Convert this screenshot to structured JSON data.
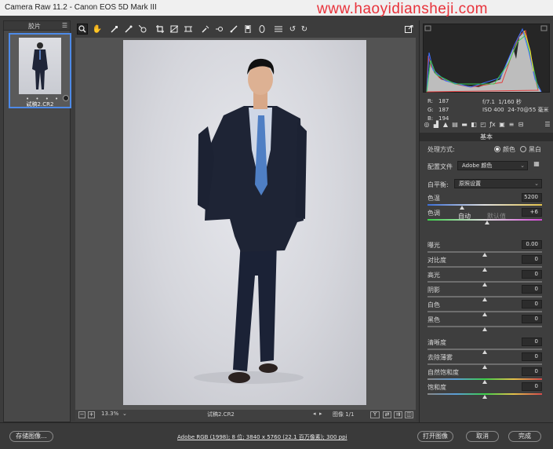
{
  "window": {
    "title": "Camera Raw 11.2 -  Canon EOS 5D Mark III",
    "watermark": "www.haoyidiansheji.com"
  },
  "filmstrip": {
    "label": "胶片",
    "thumbnail": {
      "stars": "• • • • •",
      "filename": "试稿2.CR2"
    }
  },
  "toolbar": {
    "tools": [
      "zoom-icon",
      "hand-icon",
      "white-balance-icon",
      "color-sampler-icon",
      "target-adjust-icon",
      "crop-icon",
      "straighten-icon",
      "transform-icon",
      "spot-removal-icon",
      "red-eye-icon",
      "adjustment-brush-icon",
      "graduated-filter-icon",
      "radial-filter-icon",
      "presets-icon",
      "rotate-ccw-icon",
      "rotate-cw-icon"
    ],
    "open_in_ps": "export-icon"
  },
  "bottombar": {
    "zoom": "13.3%",
    "filename": "试稿2.CR2",
    "image_count": "图像 1/1",
    "compare_label": "Y"
  },
  "histogram": {
    "r": "187",
    "g": "187",
    "b": "194",
    "r_label": "R:",
    "g_label": "G:",
    "b_label": "B:",
    "aperture": "f/7.1",
    "shutter": "1/160 秒",
    "iso": "ISO 400",
    "lens": "24-70@55 毫米"
  },
  "panel": {
    "title": "基本",
    "treatment_label": "处理方式:",
    "treatment_color": "颜色",
    "treatment_bw": "黑白",
    "profile_label": "配置文件",
    "profile_value": "Adobe 颜色",
    "wb_label": "白平衡:",
    "wb_value": "原照设置",
    "auto": "自动",
    "default": "默认值",
    "sliders": [
      {
        "label": "色温",
        "value": "5200",
        "pos": 0.3
      },
      {
        "label": "色调",
        "value": "+6",
        "pos": 0.52
      },
      {
        "label": "曝光",
        "value": "0.00",
        "pos": 0.5
      },
      {
        "label": "对比度",
        "value": "0",
        "pos": 0.5
      },
      {
        "label": "高光",
        "value": "0",
        "pos": 0.5
      },
      {
        "label": "阴影",
        "value": "0",
        "pos": 0.5
      },
      {
        "label": "白色",
        "value": "0",
        "pos": 0.5
      },
      {
        "label": "黑色",
        "value": "0",
        "pos": 0.5
      },
      {
        "label": "清晰度",
        "value": "0",
        "pos": 0.5
      },
      {
        "label": "去除薄雾",
        "value": "0",
        "pos": 0.5
      },
      {
        "label": "自然饱和度",
        "value": "0",
        "pos": 0.5
      },
      {
        "label": "饱和度",
        "value": "0",
        "pos": 0.5
      }
    ]
  },
  "footer": {
    "save": "存储图像...",
    "info": "Adobe RGB (1998); 8 位; 3840 x 5760 (22.1 百万像素); 300 ppi",
    "open": "打开图像",
    "cancel": "取消",
    "done": "完成"
  }
}
